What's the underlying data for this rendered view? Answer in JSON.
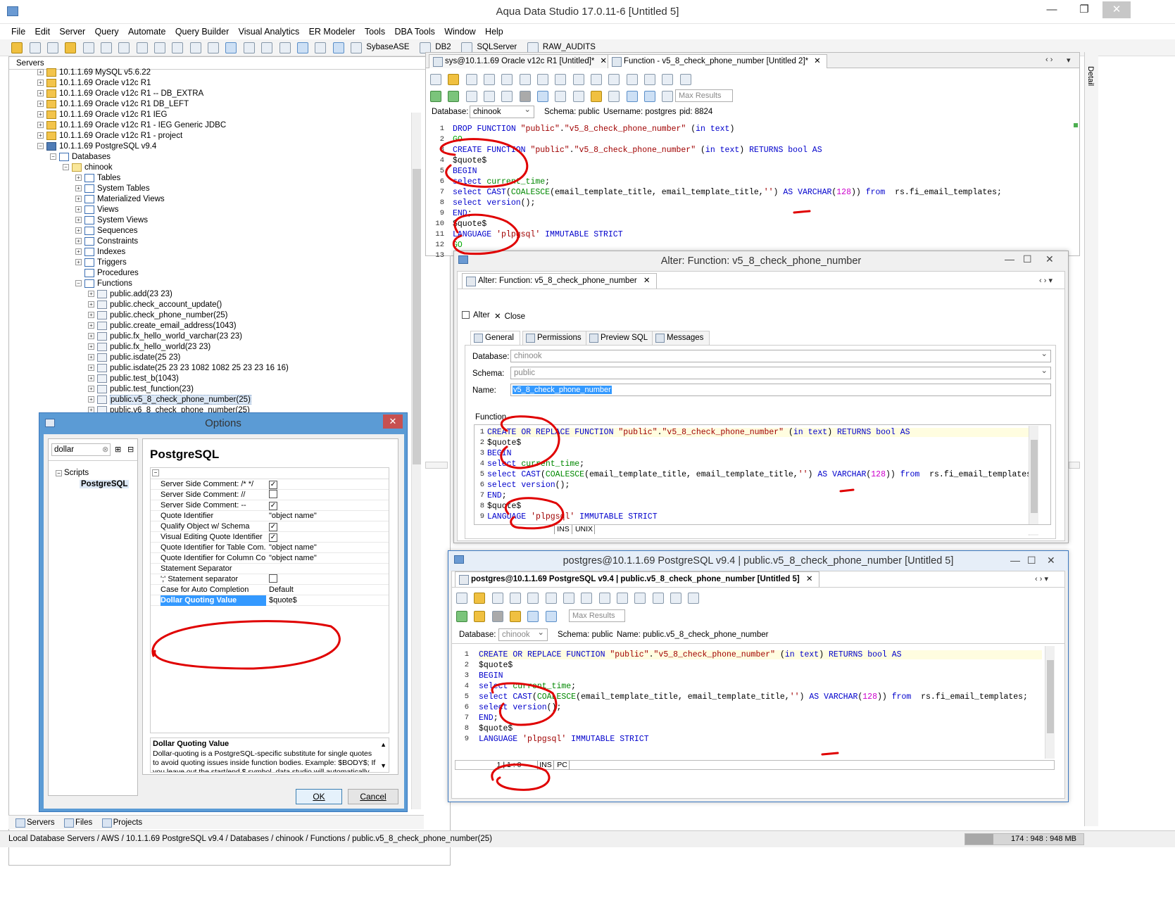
{
  "window": {
    "title": "Aqua Data Studio 17.0.11-6 [Untitled 5]"
  },
  "menu": [
    "File",
    "Edit",
    "Server",
    "Query",
    "Automate",
    "Query Builder",
    "Visual Analytics",
    "ER Modeler",
    "Tools",
    "DBA Tools",
    "Window",
    "Help"
  ],
  "toolbar": {
    "labels": [
      "SybaseASE",
      "DB2",
      "SQLServer",
      "RAW_AUDITS"
    ]
  },
  "servers": {
    "header": "Servers",
    "tree": [
      "10.1.1.69 MySQL v5.6.22",
      "10.1.1.69 Oracle  v12c R1",
      "10.1.1.69 Oracle  v12c R1 -- DB_EXTRA",
      "10.1.1.69 Oracle  v12c R1 DB_LEFT",
      "10.1.1.69 Oracle  v12c R1 IEG",
      "10.1.1.69 Oracle  v12c R1 - IEG Generic JDBC",
      "10.1.1.69 Oracle  v12c R1 - project",
      "10.1.1.69 PostgreSQL  v9.4",
      "Databases",
      "chinook",
      "Tables",
      "System Tables",
      "Materialized Views",
      "Views",
      "System Views",
      "Sequences",
      "Constraints",
      "Indexes",
      "Triggers",
      "Procedures",
      "Functions",
      "public.add(23 23)",
      "public.check_account_update()",
      "public.check_phone_number(25)",
      "public.create_email_address(1043)",
      "public.fx_hello_world_varchar(23 23)",
      "public.fx_hello_world(23 23)",
      "public.isdate(25 23)",
      "public.isdate(25 23 23 1082 1082 25 23 23 16 16)",
      "public.test_b(1043)",
      "public.test_function(23)",
      "public.v5_8_check_phone_number(25)",
      "public.v6_8_check_phone_number(25)"
    ]
  },
  "bottom_tabs": [
    "Servers",
    "Files",
    "Projects"
  ],
  "status": {
    "path": "Local Database Servers / AWS / 10.1.1.69 PostgreSQL  v9.4 / Databases / chinook / Functions / public.v5_8_check_phone_number(25)",
    "memory": "174 : 948 : 948 MB"
  },
  "editor": {
    "tabs": [
      "sys@10.1.1.69 Oracle  v12c R1 [Untitled]*",
      "Function - v5_8_check_phone_number [Untitled 2]*"
    ],
    "max_results_placeholder": "Max Results",
    "database_label": "Database:",
    "database_value": "chinook",
    "schema_text": "Schema:  public",
    "username_text": "Username:  postgres",
    "pid_text": "pid:  8824",
    "lines": [
      "DROP FUNCTION \"public\".\"v5_8_check_phone_number\" (in text)",
      "GO",
      "CREATE FUNCTION \"public\".\"v5_8_check_phone_number\" (in text) RETURNS bool AS",
      "$quote$",
      "BEGIN",
      "select current_time;",
      "select CAST(COALESCE(email_template_title, email_template_title,'') AS VARCHAR(128)) from  rs.fi_email_templates;",
      "select version();",
      "END;",
      "$quote$",
      "LANGUAGE 'plpgsql' IMMUTABLE STRICT",
      "GO",
      ""
    ],
    "side_tab": "Detail"
  },
  "alter": {
    "title": "Alter: Function: v5_8_check_phone_number",
    "tab": "Alter: Function: v5_8_check_phone_number",
    "alter_btn": "Alter",
    "close_btn": "Close",
    "subtabs": [
      "General",
      "Permissions",
      "Preview SQL",
      "Messages"
    ],
    "database_label": "Database:",
    "database_value": "chinook",
    "schema_label": "Schema:",
    "schema_value": "public",
    "name_label": "Name:",
    "name_value": "v5_8_check_phone_number",
    "function_label": "Function",
    "lines": [
      "CREATE OR REPLACE FUNCTION \"public\".\"v5_8_check_phone_number\" (in text) RETURNS bool AS",
      "$quote$",
      "BEGIN",
      "select current_time;",
      "select CAST(COALESCE(email_template_title, email_template_title,'') AS VARCHAR(128)) from  rs.fi_email_templates;",
      "select version();",
      "END;",
      "$quote$",
      "LANGUAGE 'plpgsql' IMMUTABLE STRICT"
    ],
    "status_ins": "INS",
    "status_mode": "UNIX"
  },
  "pg": {
    "title": "postgres@10.1.1.69 PostgreSQL  v9.4 | public.v5_8_check_phone_number [Untitled 5]",
    "tab": "postgres@10.1.1.69 PostgreSQL  v9.4 | public.v5_8_check_phone_number [Untitled 5]",
    "max_results_placeholder": "Max Results",
    "database_label": "Database:",
    "database_value": "chinook",
    "schema_text": "Schema:  public",
    "name_text": "Name:  public.v5_8_check_phone_number",
    "lines": [
      "CREATE OR REPLACE FUNCTION \"public\".\"v5_8_check_phone_number\" (in text) RETURNS bool AS",
      "$quote$",
      "BEGIN",
      "select current_time;",
      "select CAST(COALESCE(email_template_title, email_template_title,'') AS VARCHAR(128)) from  rs.fi_email_templates;",
      "select version();",
      "END;",
      "$quote$",
      "LANGUAGE 'plpgsql' IMMUTABLE STRICT"
    ],
    "status_pos": "1 | 1 : 0",
    "status_ins": "INS",
    "status_mode": "PC"
  },
  "options": {
    "title": "Options",
    "search": "dollar",
    "tree_root": "Scripts",
    "tree_child": "PostgreSQL",
    "heading": "PostgreSQL",
    "props": [
      {
        "k": "Server Side Comment: /* */",
        "v": "",
        "chk": true
      },
      {
        "k": "Server Side Comment: //",
        "v": "",
        "chk": false
      },
      {
        "k": "Server Side Comment: --",
        "v": "",
        "chk": true
      },
      {
        "k": "Quote Identifier",
        "v": "\"object name\""
      },
      {
        "k": "Qualify Object w/ Schema",
        "v": "",
        "chk": true
      },
      {
        "k": "Visual Editing Quote Identifier",
        "v": "",
        "chk": true
      },
      {
        "k": "Quote Identifier for Table Com...",
        "v": "\"object name\""
      },
      {
        "k": "Quote Identifier for Column Co...",
        "v": "\"object name\""
      },
      {
        "k": "Statement Separator",
        "v": ""
      },
      {
        "k": "';' Statement separator",
        "v": "",
        "chk": false
      },
      {
        "k": "Case for Auto Completion",
        "v": "Default"
      },
      {
        "k": "Dollar Quoting Value",
        "v": "$quote$",
        "sel": true
      }
    ],
    "desc_title": "Dollar Quoting Value",
    "desc_text": "Dollar-quoting is a PostgreSQL-specific substitute for single quotes to avoid quoting issues inside function bodies. Example: $BODY$; If you leave out the start/end $ symbol, data studio will automatically add",
    "ok": "OK",
    "cancel": "Cancel"
  }
}
